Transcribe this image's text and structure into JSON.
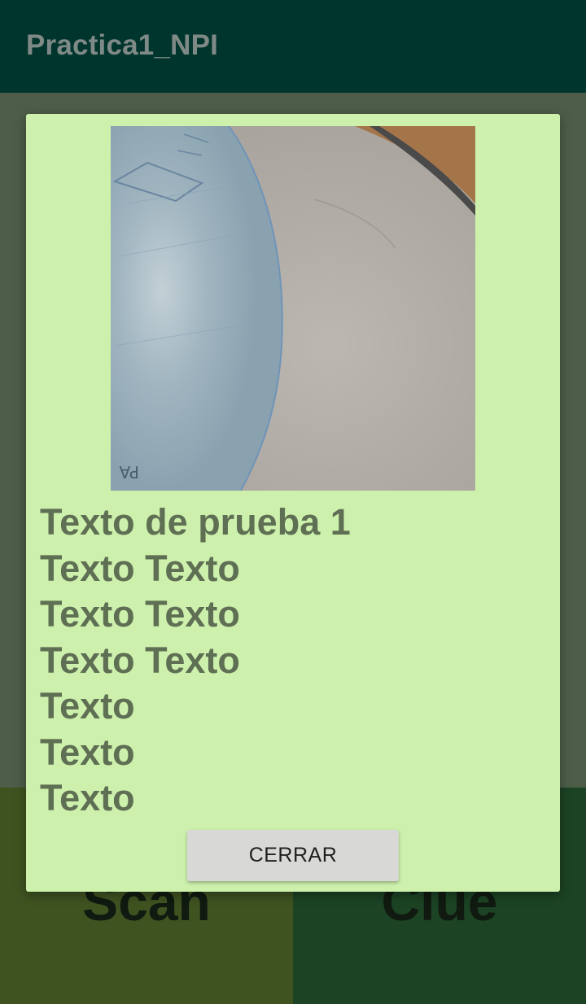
{
  "app_bar": {
    "title": "Practica1_NPI"
  },
  "buttons": {
    "scan_label": "Scan",
    "clue_label": "Clue"
  },
  "dialog": {
    "photo_icon": "captured-photo",
    "lines": [
      "Texto de prueba 1",
      "Texto Texto",
      "Texto Texto",
      "Texto Texto",
      "Texto",
      "Texto",
      "Texto"
    ],
    "close_label": "CERRAR"
  },
  "colors": {
    "app_bar": "#00352d",
    "dialog_background": "#cdf1ad",
    "scan_button": "#3f5321",
    "clue_button": "#1c4324"
  }
}
